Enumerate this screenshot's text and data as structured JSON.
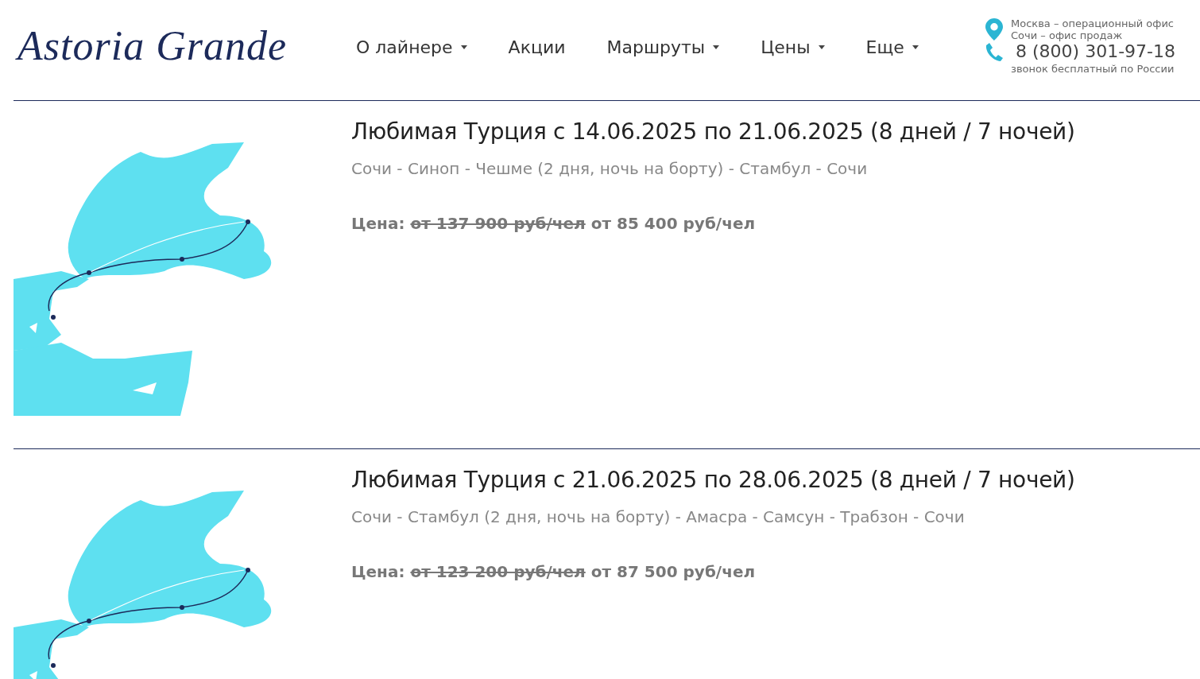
{
  "logo": "Astoria Grande",
  "nav": [
    {
      "label": "О лайнере",
      "has_dropdown": true
    },
    {
      "label": "Акции",
      "has_dropdown": false
    },
    {
      "label": "Маршруты",
      "has_dropdown": true
    },
    {
      "label": "Цены",
      "has_dropdown": true
    },
    {
      "label": "Еще",
      "has_dropdown": true
    }
  ],
  "contacts": {
    "offices": [
      "Москва – операционный офис",
      "Сочи – офис продаж"
    ],
    "phone": "8 (800) 301-97-18",
    "phone_note": "звонок бесплатный по России"
  },
  "cruises": [
    {
      "title": "Любимая Турция с 14.06.2025 по 21.06.2025 (8 дней / 7 ночей)",
      "route": "Сочи - Синоп - Чешме (2 дня, ночь на борту) - Стамбул - Сочи",
      "price_label": "Цена:",
      "old_price": "от 137 900 руб/чел",
      "price": "от 85 400 руб/чел"
    },
    {
      "title": "Любимая Турция с 21.06.2025 по 28.06.2025 (8 дней / 7 ночей)",
      "route": "Сочи - Стамбул (2 дня, ночь на борту) - Амасра - Самсун - Трабзон - Сочи",
      "price_label": "Цена:",
      "old_price": "от 123 200 руб/чел",
      "price": "от 87 500 руб/чел"
    }
  ]
}
